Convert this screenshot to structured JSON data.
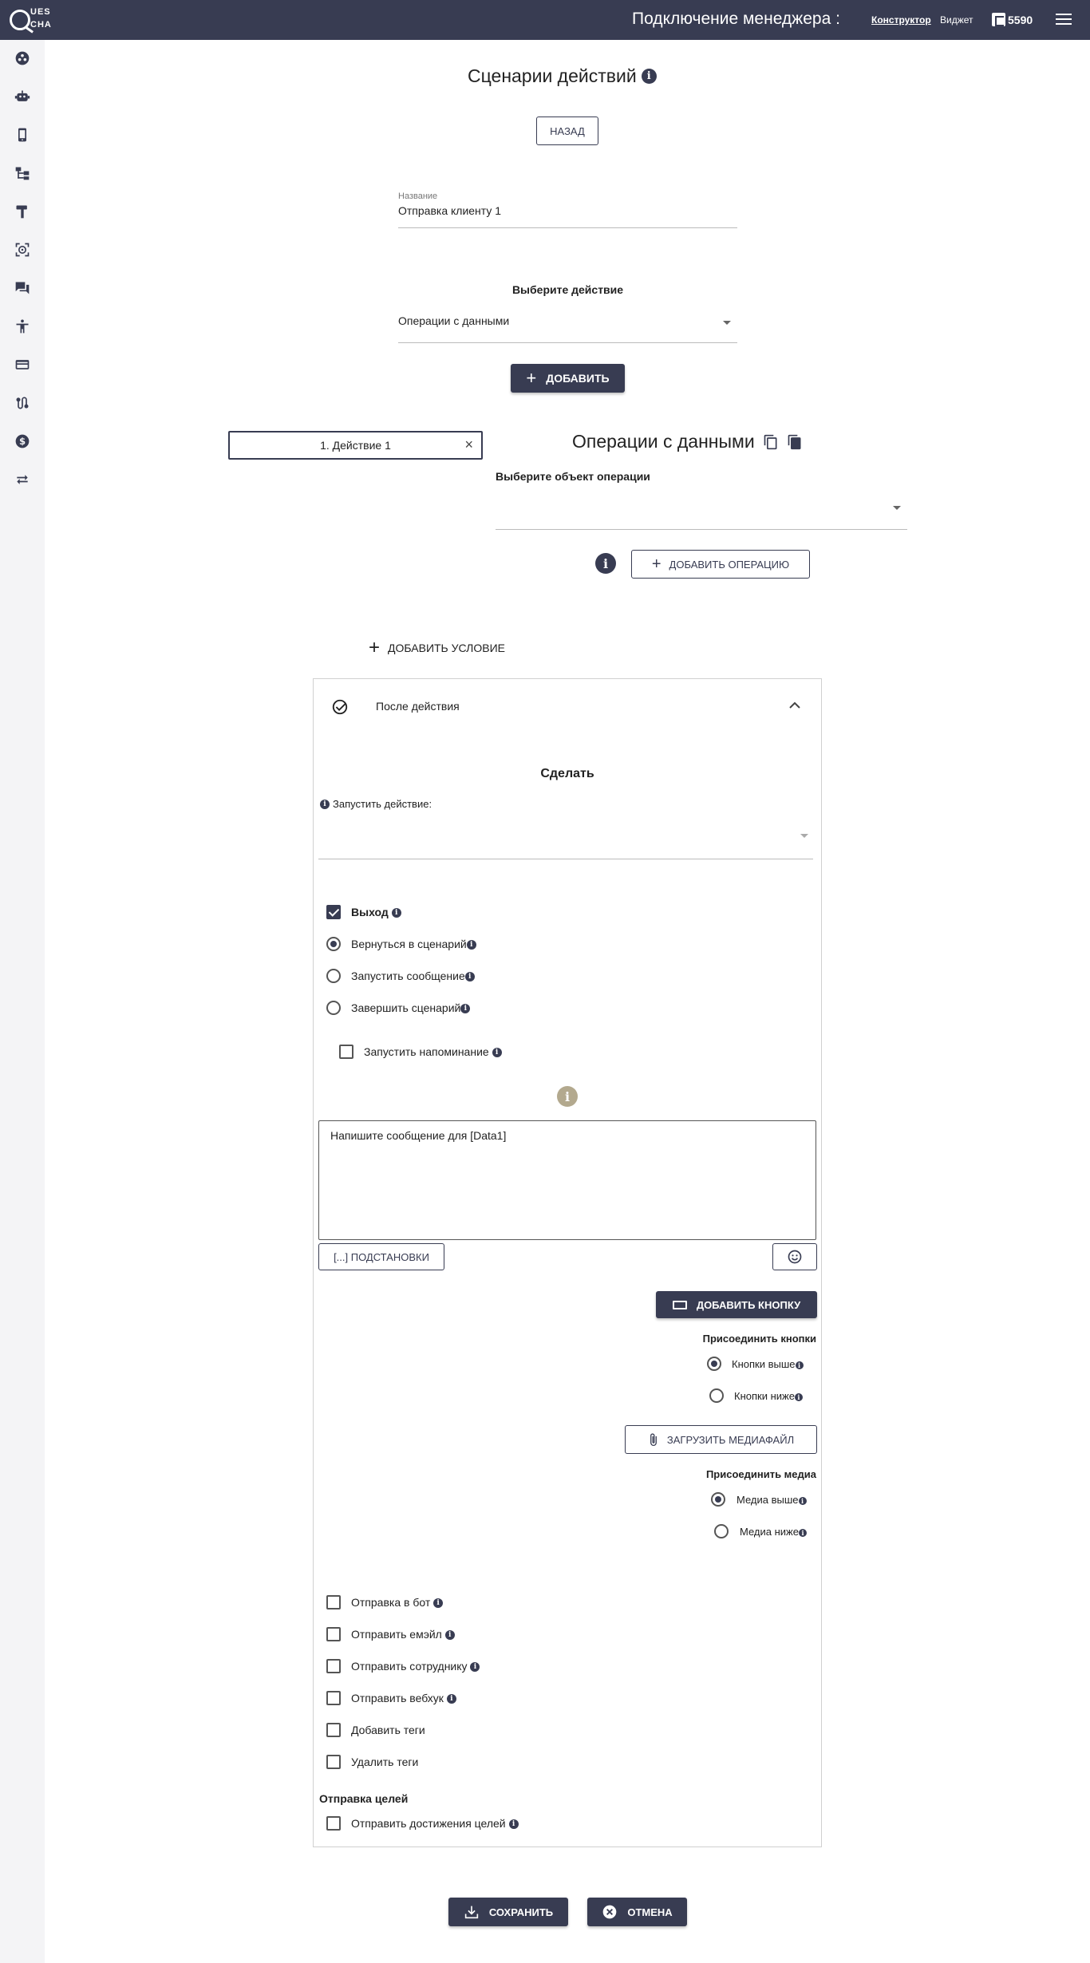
{
  "header": {
    "logo_line1": "UES",
    "logo_line2": "CHA",
    "title": "Подключение менеджера :",
    "nav_constructor": "Конструктор",
    "nav_widget": "Виджет",
    "balance": "5590"
  },
  "sidebar": {
    "icons": [
      "dashboard-icon",
      "robot-icon",
      "phone-icon",
      "hierarchy-icon",
      "hammer-icon",
      "scan-icon",
      "chat-icon",
      "accessibility-icon",
      "credit-card-icon",
      "route-icon",
      "dollar-icon",
      "swap-icon"
    ]
  },
  "page": {
    "title": "Сценарии действий",
    "back_button": "НАЗАД",
    "name_label": "Название",
    "name_value": "Отправка клиенту 1",
    "choose_action_label": "Выберите действие",
    "choose_action_value": "Операции с данными",
    "add_button": "ДОБАВИТЬ"
  },
  "actions": {
    "items": [
      "1. Действие 1"
    ],
    "close_symbol": "×"
  },
  "operation": {
    "title": "Операции с данными",
    "object_label": "Выберите объект операции",
    "object_value": "",
    "add_operation_button": "ДОБАВИТЬ ОПЕРАЦИЮ"
  },
  "condition": {
    "add_condition": "ДОБАВИТЬ УСЛОВИЕ"
  },
  "after_action": {
    "title": "После действия",
    "do_heading": "Сделать",
    "run_action_label": "Запустить действие:",
    "run_action_value": "",
    "exit_label": "Выход",
    "radio_options": [
      "Вернуться в сценарий",
      "Запустить сообщение",
      "Завершить сценарий"
    ],
    "reminder_label": "Запустить напоминание",
    "message_text": "Напишите сообщение для [Data1]",
    "substitutions_button": "[...] ПОДСТАНОВКИ",
    "add_button_label": "ДОБАВИТЬ КНОПКУ",
    "attach_buttons_heading": "Присоединить кнопки",
    "buttons_above": "Кнопки выше",
    "buttons_below": "Кнопки ниже",
    "upload_media": "ЗАГРУЗИТЬ МЕДИАФАЙЛ",
    "attach_media_heading": "Присоединить медиа",
    "media_above": "Медиа выше",
    "media_below": "Медиа ниже",
    "checkbox_options": [
      "Отправка в бот",
      "Отправить емэйл",
      "Отправить сотруднику",
      "Отправить вебхук",
      "Добавить теги",
      "Удалить теги"
    ],
    "goals_heading": "Отправка целей",
    "goals_option": "Отправить достижения целей"
  },
  "footer": {
    "save": "СОХРАНИТЬ",
    "cancel": "ОТМЕНА"
  },
  "colors": {
    "primary": "#383c52",
    "info_muted": "#b3a98e"
  }
}
